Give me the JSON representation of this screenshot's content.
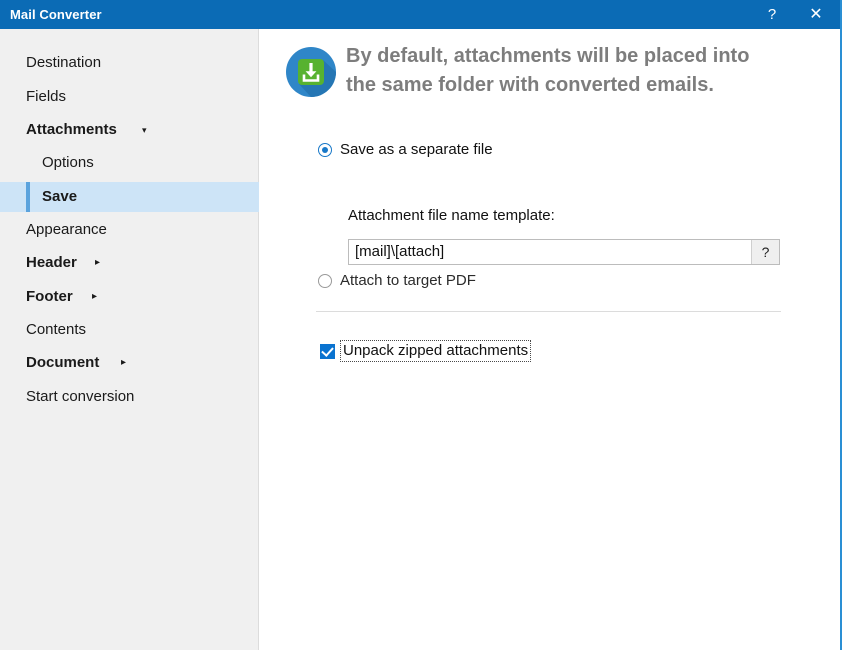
{
  "window": {
    "title": "Mail Converter",
    "help_button": "?",
    "close_button": "✕"
  },
  "sidebar": {
    "items": [
      {
        "label": "Destination",
        "indent": false,
        "bold": false,
        "selected": false,
        "chevron": ""
      },
      {
        "label": "Fields",
        "indent": false,
        "bold": false,
        "selected": false,
        "chevron": ""
      },
      {
        "label": "Attachments",
        "indent": false,
        "bold": true,
        "selected": false,
        "chevron": "▾"
      },
      {
        "label": "Options",
        "indent": true,
        "bold": false,
        "selected": false,
        "chevron": ""
      },
      {
        "label": "Save",
        "indent": true,
        "bold": true,
        "selected": true,
        "chevron": ""
      },
      {
        "label": "Appearance",
        "indent": false,
        "bold": false,
        "selected": false,
        "chevron": ""
      },
      {
        "label": "Header",
        "indent": false,
        "bold": true,
        "selected": false,
        "chevron": "▸"
      },
      {
        "label": "Footer",
        "indent": false,
        "bold": true,
        "selected": false,
        "chevron": "▸"
      },
      {
        "label": "Contents",
        "indent": false,
        "bold": false,
        "selected": false,
        "chevron": ""
      },
      {
        "label": "Document",
        "indent": false,
        "bold": true,
        "selected": false,
        "chevron": "▸"
      },
      {
        "label": "Start conversion",
        "indent": false,
        "bold": false,
        "selected": false,
        "chevron": ""
      }
    ]
  },
  "main": {
    "header_icon": "download-attachment-icon",
    "heading_line1": "By default, attachments will be placed into",
    "heading_line2": "the same folder with converted emails.",
    "radio_save_separate": "Save as a separate file",
    "radio_attach_pdf": "Attach to target PDF",
    "template_label": "Attachment file name template:",
    "template_value": "[mail]\\[attach]",
    "template_help_button": "?",
    "checkbox_unpack": "Unpack zipped attachments"
  },
  "colors": {
    "titlebar": "#0b6bb5",
    "sidebar": "#f0f0f0",
    "selection": "#cde4f7",
    "accent_bar": "#5ba3dd",
    "heading_text": "#7d7d7d",
    "checkbox_blue": "#0a73d0",
    "radio_blue": "#1878c8",
    "icon_circle_blue": "#2f86c8",
    "icon_square_green": "#57b230"
  }
}
